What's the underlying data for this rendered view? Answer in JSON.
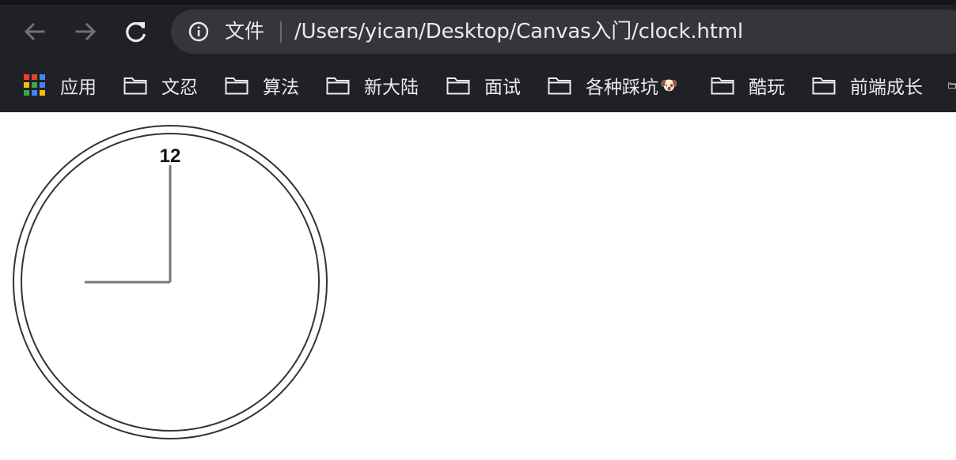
{
  "browser": {
    "nav": {
      "back_icon": "arrow-left-icon",
      "forward_icon": "arrow-right-icon",
      "reload_icon": "reload-icon"
    },
    "omnibox": {
      "info_icon": "info-icon",
      "scheme_label": "文件",
      "url": "/Users/yican/Desktop/Canvas入门/clock.html"
    },
    "bookmarks": [
      {
        "label": "应用",
        "icon": "apps-grid-icon"
      },
      {
        "label": "文忍",
        "icon": "folder-icon"
      },
      {
        "label": "算法",
        "icon": "folder-icon"
      },
      {
        "label": "新大陆",
        "icon": "folder-icon"
      },
      {
        "label": "面试",
        "icon": "folder-icon"
      },
      {
        "label": "各种踩坑",
        "icon": "folder-icon",
        "emoji": "🐶"
      },
      {
        "label": "酷玩",
        "icon": "folder-icon"
      },
      {
        "label": "前端成长",
        "icon": "folder-icon"
      }
    ]
  },
  "clock": {
    "numeral": "12",
    "time": {
      "hour": 9,
      "minute": 0
    }
  },
  "colors": {
    "chrome_bg": "#202124",
    "omnibox_bg": "#35363a",
    "text_light": "#e8eaed",
    "clock_stroke": "#333333",
    "hand_color": "#777777"
  }
}
